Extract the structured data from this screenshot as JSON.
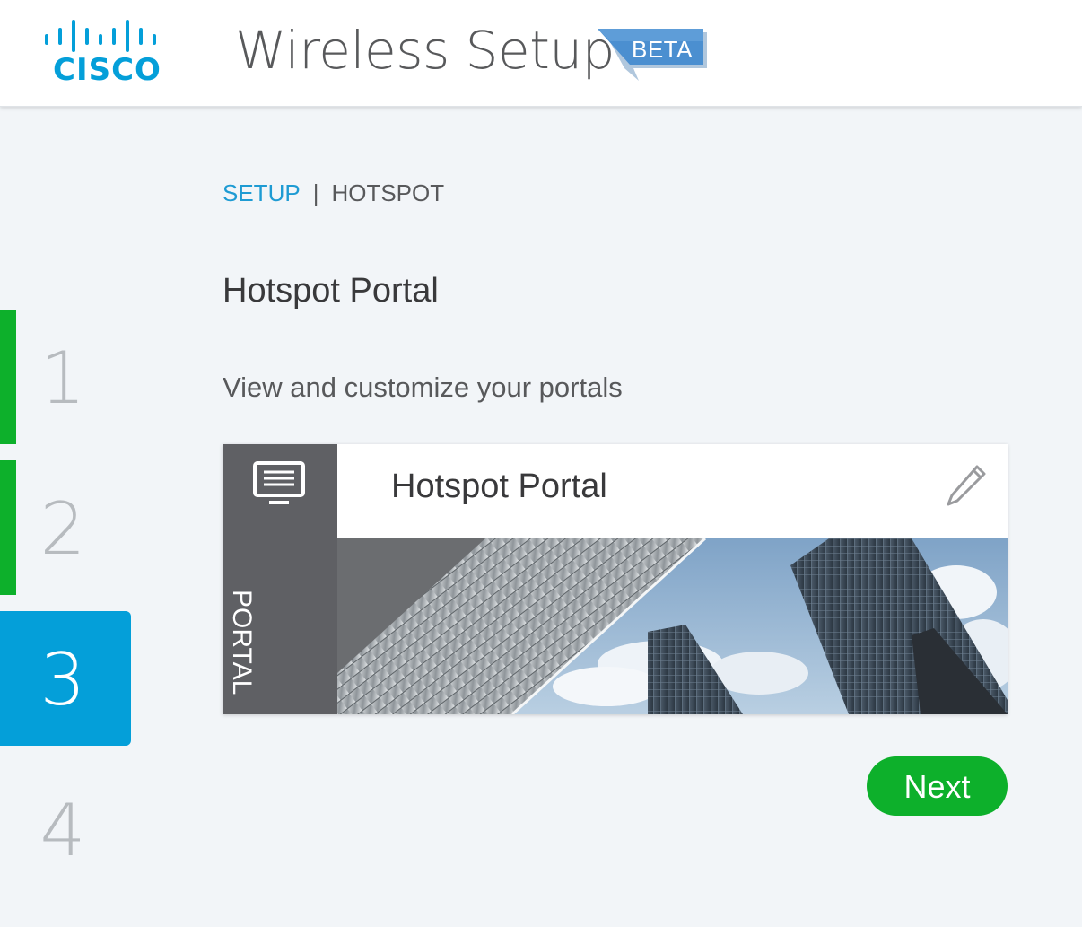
{
  "header": {
    "logo_text": "CISCO",
    "logo_icon": "cisco-bars-logo",
    "title": "Wireless Setup",
    "badge": "BETA"
  },
  "steps": [
    {
      "label": "1",
      "state": "completed"
    },
    {
      "label": "2",
      "state": "completed"
    },
    {
      "label": "3",
      "state": "active"
    },
    {
      "label": "4",
      "state": "pending"
    }
  ],
  "breadcrumb": {
    "parent": "SETUP",
    "separator": "|",
    "current": "HOTSPOT"
  },
  "page": {
    "title": "Hotspot Portal",
    "subtitle": "View and customize your portals"
  },
  "portal_card": {
    "type_label": "PORTAL",
    "type_icon": "monitor-icon",
    "name": "Hotspot Portal",
    "edit_icon": "pencil-icon",
    "image": "skyscrapers-photo"
  },
  "actions": {
    "next_label": "Next"
  },
  "colors": {
    "accent_blue": "#049fd9",
    "success_green": "#0db02b",
    "panel_gray": "#5f6064",
    "background": "#f2f5f8"
  }
}
